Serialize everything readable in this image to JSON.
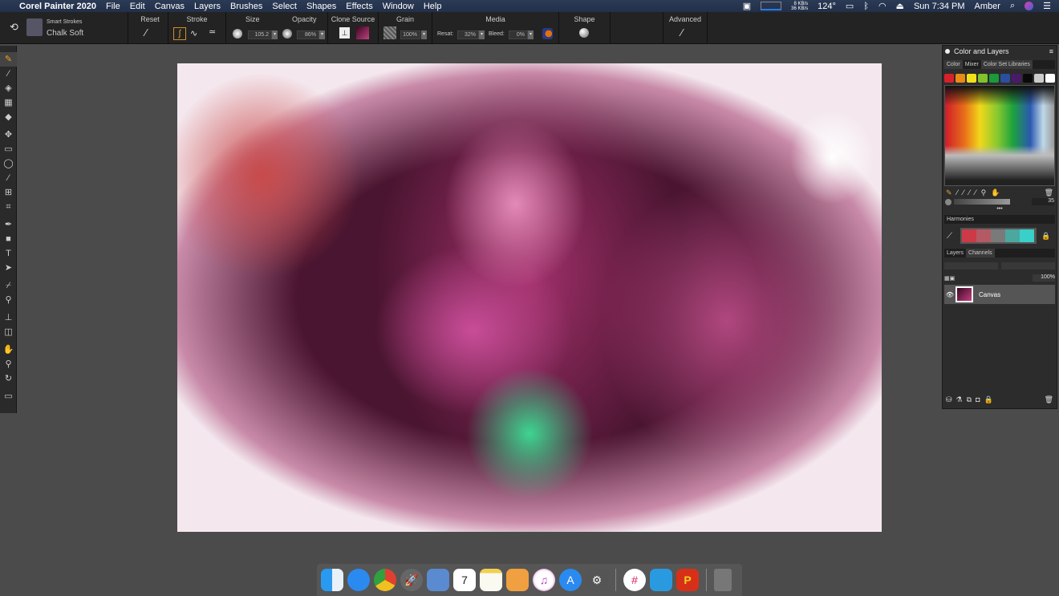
{
  "menubar": {
    "app": "Corel Painter 2020",
    "items": [
      "File",
      "Edit",
      "Canvas",
      "Layers",
      "Brushes",
      "Select",
      "Shapes",
      "Effects",
      "Window",
      "Help"
    ],
    "status": {
      "net_up": "8 KB/s",
      "net_down": "36 KB/s",
      "temp": "124°",
      "clock": "Sun 7:34 PM",
      "user": "Amber"
    }
  },
  "toolbar": {
    "brush_category": "Smart Strokes",
    "brush_name": "Chalk Soft",
    "reset": "Reset",
    "stroke": "Stroke",
    "size": "Size",
    "size_value": "105.2",
    "opacity": "Opacity",
    "opacity_value": "86%",
    "clone_source": "Clone Source",
    "grain": "Grain",
    "grain_value": "100%",
    "media": "Media",
    "resat_label": "Resat:",
    "resat_value": "32%",
    "bleed_label": "Bleed:",
    "bleed_value": "0%",
    "shape": "Shape",
    "advanced": "Advanced"
  },
  "toolbox": {
    "icons": [
      "brush",
      "dropper",
      "paint-bucket",
      "gradient",
      "eraser",
      "transform",
      "rect-select",
      "lasso",
      "magic-wand",
      "move",
      "crop",
      "pen",
      "shape",
      "text",
      "selector",
      "mirror",
      "dodge",
      "perspective",
      "warp",
      "rotate",
      "magnifier",
      "rotate-page",
      "screen-mode"
    ]
  },
  "panel": {
    "title": "Color and Layers",
    "tabs": [
      "Color",
      "Mixer",
      "Color Set Libraries"
    ],
    "swatches": [
      "#d8202a",
      "#ea8a14",
      "#f2e018",
      "#82c22a",
      "#1a9a3a",
      "#2c4ea0",
      "#4a1a6a",
      "#0a0a0a",
      "#cccccc",
      "#ffffff"
    ],
    "mixer_value": "35",
    "harmonies": "Harmonies",
    "harmony_colors": [
      "#cc3a48",
      "#b45a64",
      "#7a7a7a",
      "#4aa8a0",
      "#38d0c8"
    ],
    "layers_tabs": [
      "Layers",
      "Channels"
    ],
    "layer_opacity": "100%",
    "layers": [
      {
        "name": "Canvas",
        "visible": true
      }
    ]
  },
  "dock": {
    "apps": [
      "Finder",
      "Messages",
      "Chrome",
      "Launchpad",
      "Preview",
      "Calendar",
      "Notes",
      "Pages",
      "iTunes",
      "App Store",
      "System Preferences",
      "Slack",
      "Affinity Designer",
      "Painter",
      "Trash"
    ],
    "calendar_day": "7"
  }
}
